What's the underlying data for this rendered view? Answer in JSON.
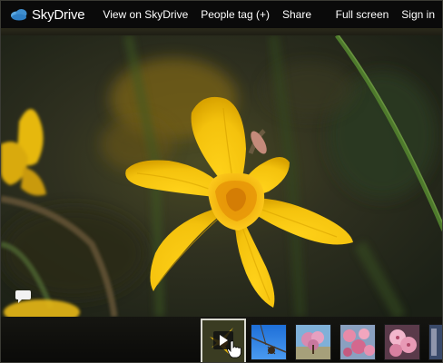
{
  "topbar": {
    "logo_text": "SkyDrive",
    "view_link": "View on SkyDrive",
    "people_tag": "People tag (+)",
    "share": "Share",
    "full_screen": "Full screen",
    "sign_in": "Sign in"
  },
  "colors": {
    "topbar_bg": "#0a0a0a",
    "petal_yellow": "#f3c30e",
    "skydrive_cloud": "#5aa7e0"
  },
  "icons": {
    "comment": "speech-bubble-icon",
    "play": "play-icon",
    "cursor": "hand-cursor-icon"
  },
  "filmstrip": {
    "thumbs": [
      {
        "subject": "daffodil",
        "selected": true,
        "play_overlay": true
      },
      {
        "subject": "bird-branch-sky"
      },
      {
        "subject": "pink-blossom-tree"
      },
      {
        "subject": "pink-blossoms"
      },
      {
        "subject": "pink-blossom-closeup"
      },
      {
        "subject": "partial-thumbnail"
      }
    ]
  }
}
